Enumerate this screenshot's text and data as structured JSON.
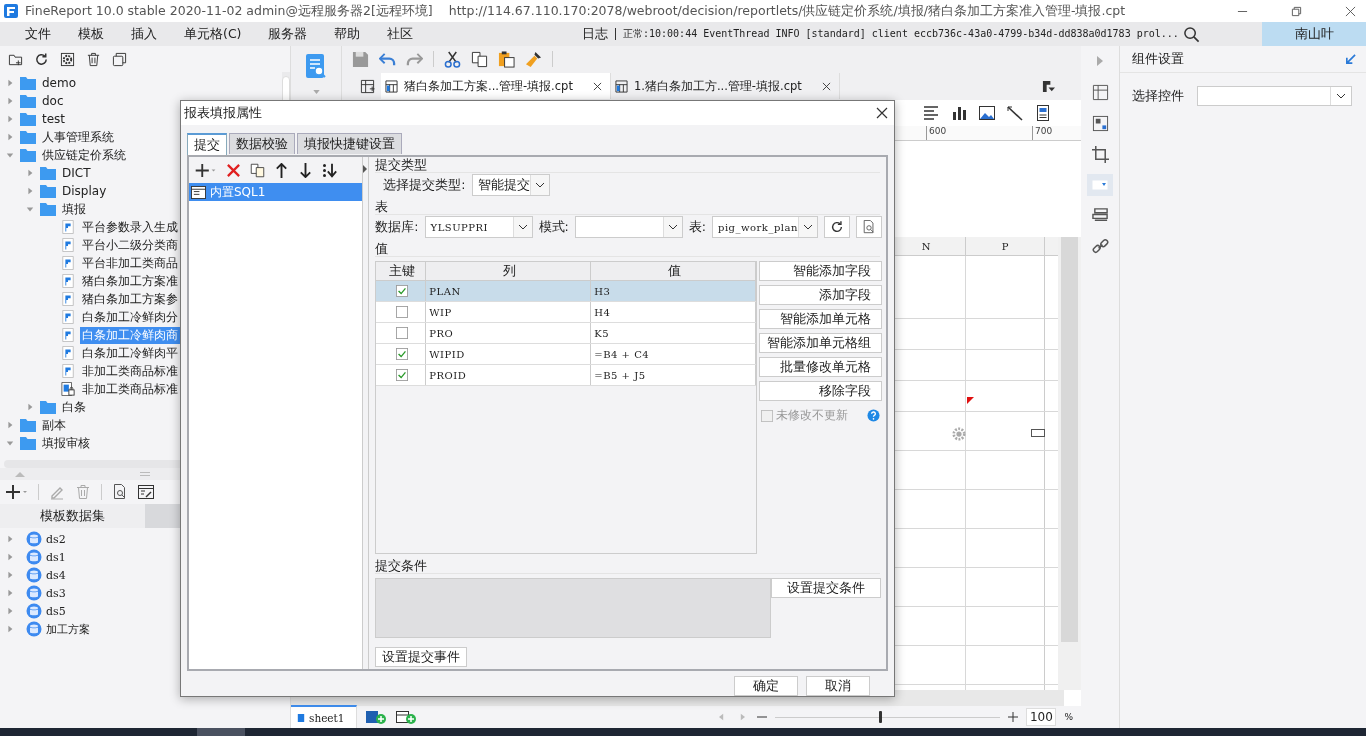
{
  "window": {
    "title": "FineReport 10.0 stable 2020-11-02 admin@远程服务器2[远程环境]",
    "url": "http://114.67.110.170:2078/webroot/decision/reportlets/供应链定价系统/填报/猪白条加工方案准入管理-填报.cpt"
  },
  "menu": [
    "文件",
    "模板",
    "插入",
    "单元格(C)",
    "服务器",
    "帮助",
    "社区"
  ],
  "log": {
    "label": "日志",
    "message": "正常:10:00:44 EventThread INFO [standard] client eccb736c-43a0-4799-b34d-dd838a0d1783 prol..."
  },
  "user": "南山叶",
  "template_tree": [
    {
      "label": "demo",
      "kind": "folder",
      "expanded": false,
      "selected": false
    },
    {
      "label": "doc",
      "kind": "folder",
      "expanded": false,
      "selected": false
    },
    {
      "label": "test",
      "kind": "folder",
      "expanded": false,
      "selected": false
    },
    {
      "label": "人事管理系统",
      "kind": "folder",
      "expanded": false,
      "selected": false
    },
    {
      "label": "供应链定价系统",
      "kind": "folder",
      "expanded": true,
      "selected": false,
      "children": [
        {
          "label": "DICT",
          "kind": "folder",
          "expanded": false,
          "selected": false
        },
        {
          "label": "Display",
          "kind": "folder",
          "expanded": false,
          "selected": false
        },
        {
          "label": "填报",
          "kind": "folder",
          "expanded": true,
          "selected": false,
          "children": [
            {
              "label": "平台参数录入生成",
              "kind": "report",
              "selected": false
            },
            {
              "label": "平台小二级分类商",
              "kind": "report",
              "selected": false
            },
            {
              "label": "平台非加工类商品",
              "kind": "report",
              "selected": false
            },
            {
              "label": "猪白条加工方案准",
              "kind": "report",
              "selected": false
            },
            {
              "label": "猪白条加工方案参",
              "kind": "report",
              "selected": false
            },
            {
              "label": "白条加工冷鲜肉分",
              "kind": "report",
              "selected": false
            },
            {
              "label": "白条加工冷鲜肉商",
              "kind": "report",
              "selected": true
            },
            {
              "label": "白条加工冷鲜肉平",
              "kind": "report",
              "selected": false
            },
            {
              "label": "非加工类商品标准",
              "kind": "report",
              "selected": false
            },
            {
              "label": "非加工类商品标准",
              "kind": "locked_report",
              "selected": false
            }
          ]
        },
        {
          "label": "白条",
          "kind": "folder",
          "expanded": false,
          "selected": false
        }
      ]
    },
    {
      "label": "副本",
      "kind": "folder",
      "expanded": false,
      "selected": false
    },
    {
      "label": "填报审核",
      "kind": "folder",
      "expanded": true,
      "selected": false
    }
  ],
  "datasets": {
    "header": "模板数据集",
    "items": [
      {
        "label": "ds2",
        "expanded": false
      },
      {
        "label": "ds1",
        "expanded": false
      },
      {
        "label": "ds4",
        "expanded": false
      },
      {
        "label": "ds3",
        "expanded": false
      },
      {
        "label": "ds5",
        "expanded": false
      },
      {
        "label": "加工方案",
        "expanded": false
      }
    ]
  },
  "tabs": [
    {
      "label": "猪白条加工方案...管理-填报.cpt",
      "selected": true
    },
    {
      "label": "1.猪白条加工方...管理-填报.cpt",
      "selected": false
    }
  ],
  "ruler": [
    "600",
    "700"
  ],
  "columns": [
    "N",
    "P"
  ],
  "sheets": [
    {
      "label": "sheet1",
      "selected": true
    }
  ],
  "zoom": {
    "level": 0.46,
    "value": "100",
    "unit": "%"
  },
  "right_panel": {
    "title": "组件设置",
    "label": "选择控件"
  },
  "dialog": {
    "title": "报表填报属性",
    "tabs": [
      {
        "label": "提交",
        "selected": true
      },
      {
        "label": "数据校验",
        "selected": false
      },
      {
        "label": "填报快捷键设置",
        "selected": false
      }
    ],
    "items": [
      {
        "label": "内置SQL1",
        "selected": true
      }
    ],
    "submit_type": {
      "section": "提交类型",
      "label": "选择提交类型:",
      "value": "智能提交"
    },
    "table": {
      "section": "表",
      "db_label": "数据库:",
      "db_value": "YLSUPPRI",
      "schema_label": "模式:",
      "table_label": "表:",
      "table_value": "pig_work_plan"
    },
    "values": {
      "section": "值",
      "columns": [
        "主键",
        "列",
        "值"
      ],
      "rows": [
        {
          "key": true,
          "column": "PLAN",
          "value": "H3",
          "selected": true
        },
        {
          "key": false,
          "column": "WIP",
          "value": "H4",
          "selected": false
        },
        {
          "key": false,
          "column": "PRO",
          "value": "K5",
          "selected": false
        },
        {
          "key": true,
          "column": "WIPID",
          "value": "=B4 + C4",
          "selected": false
        },
        {
          "key": true,
          "column": "PROID",
          "value": "=B5 + J5",
          "selected": false
        }
      ],
      "buttons": [
        "智能添加字段",
        "添加字段",
        "智能添加单元格",
        "智能添加单元格组",
        "批量修改单元格",
        "移除字段"
      ],
      "unchanged": {
        "label": "未修改不更新",
        "checked": false,
        "disabled": true
      }
    },
    "condition": {
      "section": "提交条件",
      "button": "设置提交条件"
    },
    "event_button": "设置提交事件",
    "footer": [
      "确定",
      "取消"
    ]
  }
}
